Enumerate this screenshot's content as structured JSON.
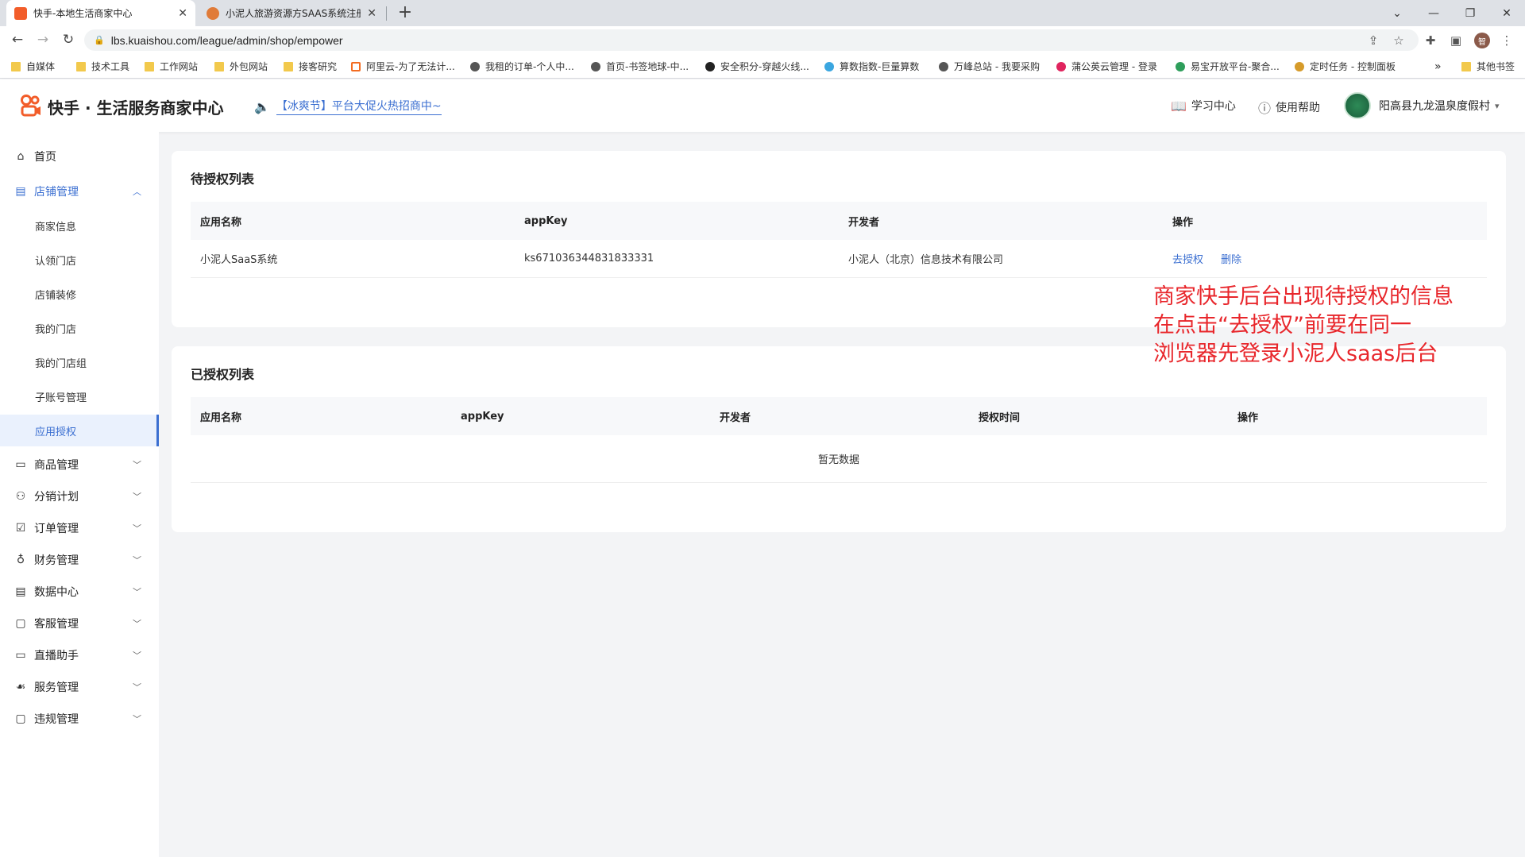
{
  "browser": {
    "tabs": [
      {
        "title": "快手-本地生活商家中心",
        "favicon_color": "#f25d2a",
        "active": true
      },
      {
        "title": "小泥人旅游资源方SAAS系统注册",
        "favicon_color": "#e07b39",
        "active": false
      }
    ],
    "new_tab": "+",
    "window": {
      "minimize": "—",
      "restore": "❐",
      "close": "✕"
    },
    "url": "lbs.kuaishou.com/league/admin/shop/empower",
    "bookmarks": [
      {
        "label": "自媒体",
        "icon": "folder"
      },
      {
        "label": "技术工具",
        "icon": "folder"
      },
      {
        "label": "工作网站",
        "icon": "folder"
      },
      {
        "label": "外包网站",
        "icon": "folder"
      },
      {
        "label": "接客研究",
        "icon": "folder"
      },
      {
        "label": "阿里云-为了无法计...",
        "icon": "aliyun"
      },
      {
        "label": "我租的订单-个人中...",
        "icon": "globe"
      },
      {
        "label": "首页-书签地球-中...",
        "icon": "globe"
      },
      {
        "label": "安全积分-穿越火线...",
        "icon": "globe"
      },
      {
        "label": "算数指数-巨量算数",
        "icon": "globe"
      },
      {
        "label": "万峰总站 - 我要采购",
        "icon": "globe"
      },
      {
        "label": "蒲公英云管理 - 登录",
        "icon": "globe"
      },
      {
        "label": "易宝开放平台-聚合...",
        "icon": "globe"
      },
      {
        "label": "定时任务 - 控制面板",
        "icon": "globe"
      }
    ],
    "bookmarks_more": "»",
    "other_bookmarks": "其他书签",
    "profile_initial": "智"
  },
  "header": {
    "brand": "快手 · 生活服务商家中心",
    "notice": "【冰爽节】平台大促火热招商中~",
    "learning_center": "学习中心",
    "help": "使用帮助",
    "shop_name": "阳高县九龙温泉度假村"
  },
  "sidebar": {
    "home": "首页",
    "store_mgmt": "店铺管理",
    "store_sub": [
      "商家信息",
      "认领门店",
      "店铺装修",
      "我的门店",
      "我的门店组",
      "子账号管理",
      "应用授权"
    ],
    "selected_sub": "应用授权",
    "menu": [
      "商品管理",
      "分销计划",
      "订单管理",
      "财务管理",
      "数据中心",
      "客服管理",
      "直播助手",
      "服务管理",
      "违规管理"
    ]
  },
  "pending": {
    "title": "待授权列表",
    "columns": [
      "应用名称",
      "appKey",
      "开发者",
      "操作"
    ],
    "rows": [
      {
        "app": "小泥人SaaS系统",
        "appkey": "ks671036344831833331",
        "developer": "小泥人（北京）信息技术有限公司",
        "action_authorize": "去授权",
        "action_delete": "删除"
      }
    ]
  },
  "authorized": {
    "title": "已授权列表",
    "columns": [
      "应用名称",
      "appKey",
      "开发者",
      "授权时间",
      "操作"
    ],
    "empty": "暂无数据"
  },
  "annotation": [
    "商家快手后台出现待授权的信息",
    "在点击“去授权”前要在同一",
    "浏览器先登录小泥人saas后台"
  ],
  "colors": {
    "accent": "#3b6fd1",
    "annotation": "#e8262b",
    "brand_orange": "#f25d2a"
  }
}
